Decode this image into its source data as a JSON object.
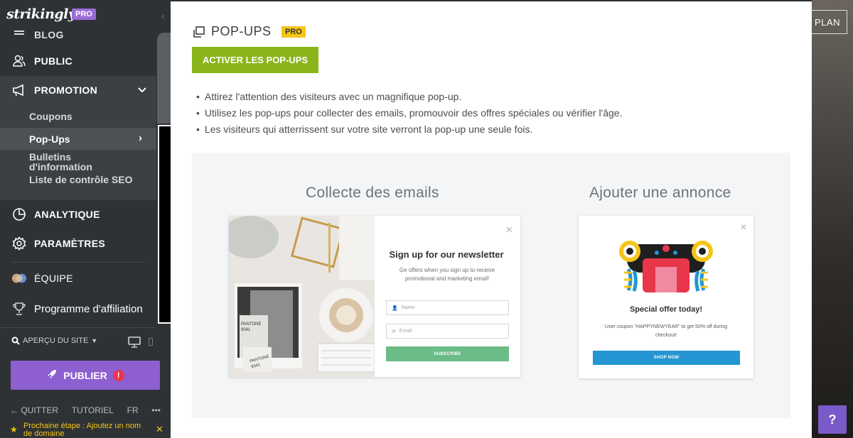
{
  "sidebar": {
    "logo": "strikingly",
    "logo_badge": "PRO",
    "nav": {
      "blog": "BLOG",
      "public": "PUBLIC",
      "promotion": "PROMOTION",
      "analytique": "ANALYTIQUE",
      "parametres": "PARAMÈTRES",
      "equipe": "ÉQUIPE",
      "affiliation": "Programme d'affiliation"
    },
    "promotion_sub": {
      "coupons": "Coupons",
      "popups": "Pop-Ups",
      "bulletins": "Bulletins d'information",
      "seo": "Liste de contrôle SEO"
    },
    "apercu": "APERÇU DU SITE",
    "publier": "PUBLIER",
    "publier_warning": "!",
    "footer": {
      "quitter": "QUITTER",
      "tutoriel": "TUTORIEL",
      "lang": "FR",
      "more": "•••"
    },
    "next_step": "Prochaine étape : Ajoutez un nom de domaine"
  },
  "topbar": {
    "plan_label": "PLAN",
    "help_label": "?"
  },
  "main": {
    "title": "POP-UPS",
    "pro_badge": "PRO",
    "activate_button": "ACTIVER LES POP-UPS",
    "bullets": [
      "Attirez l'attention des visiteurs avec un magnifique pop-up.",
      "Utilisez les pop-ups pour collecter des emails, promouvoir des offres spéciales ou vérifier l'âge.",
      "Les visiteurs qui atterrissent sur votre site verront la pop-up une seule fois."
    ],
    "preview": {
      "emails_title": "Collecte des emails",
      "annonce_title": "Ajouter une annonce",
      "newsletter": {
        "title": "Sign up for our newsletter",
        "desc": "Ge offers when you sign up to receive promotional and marketing email!",
        "name_placeholder": "Name",
        "email_placeholder": "Email",
        "subscribe": "SUBSCRIBE",
        "image_labels": [
          "PANTONE 9041",
          "PANTONE 9341"
        ]
      },
      "ad": {
        "title": "Special offer today!",
        "desc": "User coupon \"HAPPYNEWYEAR\" to get 50% off during checkout!",
        "shop": "SHOP NOW"
      }
    }
  },
  "colors": {
    "sidebar_bg": "#2f3235",
    "active_section_bg": "#3c4043",
    "publish_purple": "#8e5fd0",
    "activate_green": "#8ab51a",
    "pro_yellow": "#f5c518",
    "subscribe_green": "#6cbc87",
    "shop_blue": "#2396d3"
  },
  "icons": {
    "blog": "blog-icon",
    "public": "people-icon",
    "promotion": "megaphone-icon",
    "analytique": "pie-chart-icon",
    "parametres": "gear-icon",
    "equipe": "team-icon",
    "affiliation": "trophy-icon",
    "title": "popup-window-icon"
  }
}
